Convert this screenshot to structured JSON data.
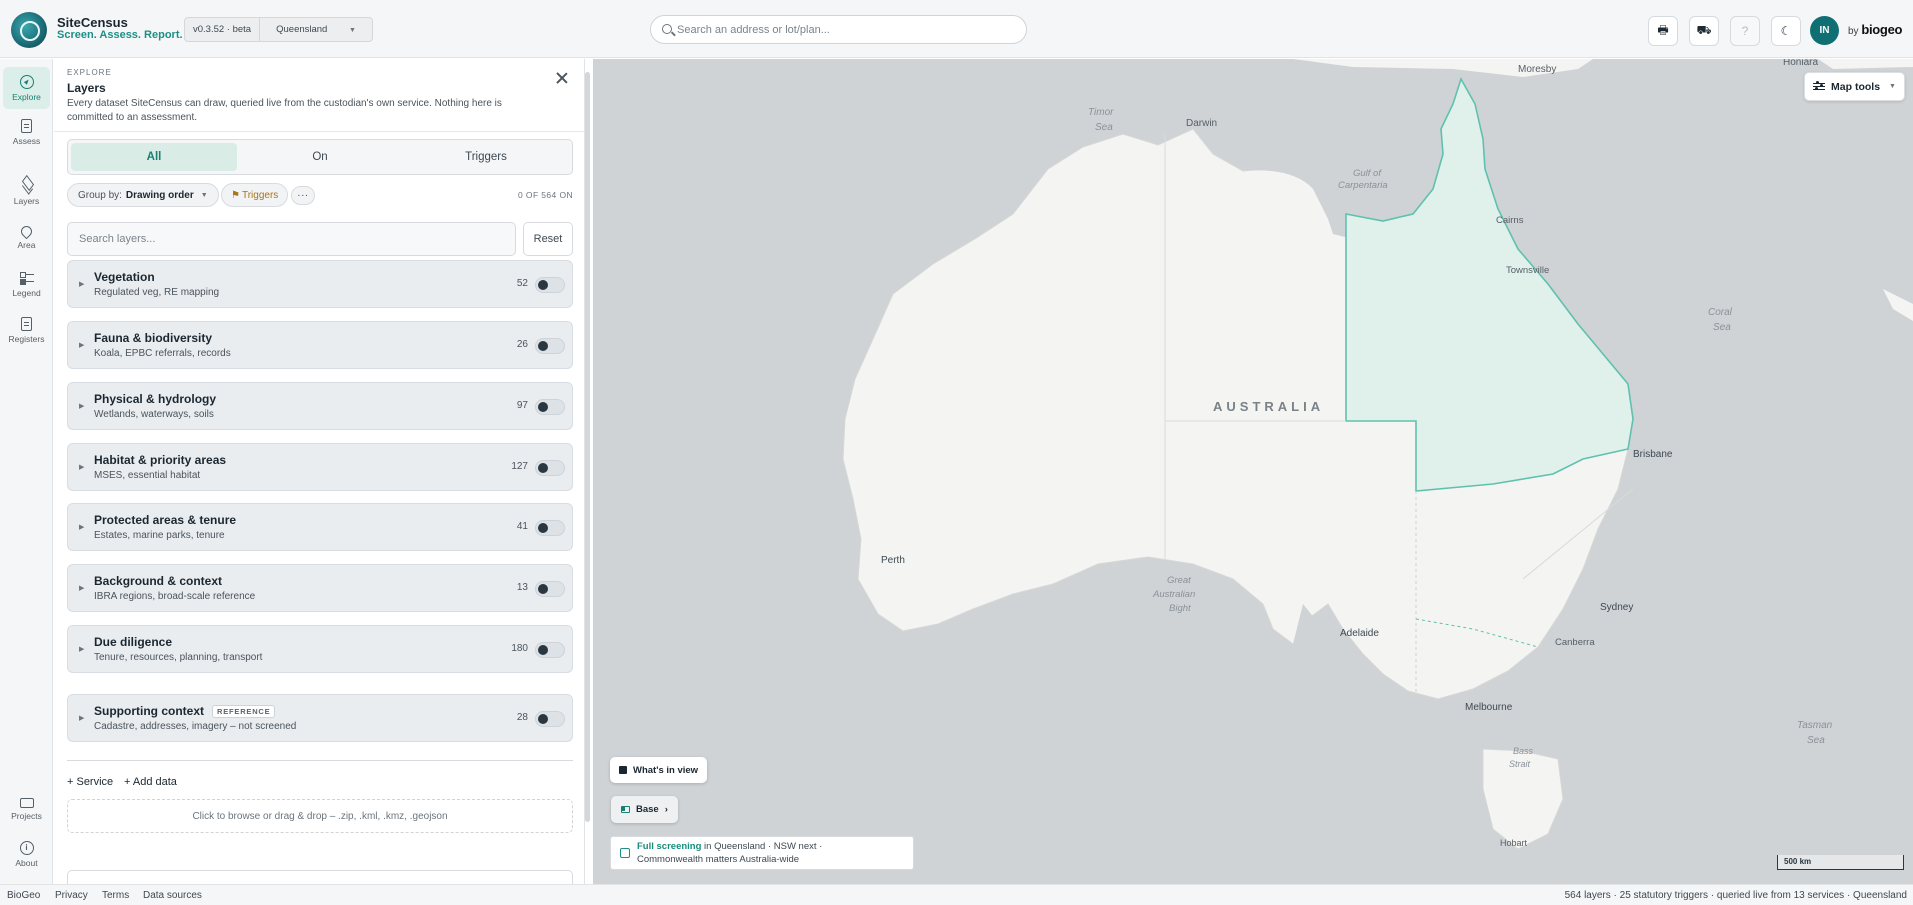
{
  "header": {
    "brand_name": "SiteCensus",
    "brand_tagline": "Screen. Assess. Report.",
    "version": "v0.3.52 · beta",
    "region": "Queensland",
    "search_placeholder": "Search an address or lot/plan...",
    "avatar_initials": "IN",
    "byline_prefix": "by",
    "byline_brand": "biogeo",
    "buttons": [
      "printer-icon",
      "vehicle-icon",
      "help-icon",
      "moon-icon"
    ]
  },
  "rail": {
    "top_items": [
      {
        "label": "Explore",
        "icon": "compass-icon",
        "active": true
      },
      {
        "label": "Assess",
        "icon": "document-icon",
        "active": false
      },
      {
        "label": "Layers",
        "icon": "layers-icon",
        "active": false
      },
      {
        "label": "Area",
        "icon": "map-pin-icon",
        "active": false
      },
      {
        "label": "Legend",
        "icon": "legend-icon",
        "active": false
      },
      {
        "label": "Registers",
        "icon": "register-icon",
        "active": false
      }
    ],
    "bottom_items": [
      {
        "label": "Projects",
        "icon": "folder-icon"
      },
      {
        "label": "About",
        "icon": "info-icon"
      }
    ]
  },
  "panel": {
    "eyebrow": "EXPLORE",
    "title": "Layers",
    "description": "Every dataset SiteCensus can draw, queried live from the custodian's own service. Nothing here is committed to an assessment.",
    "tabs": [
      {
        "label": "All",
        "active": true
      },
      {
        "label": "On",
        "active": false
      },
      {
        "label": "Triggers",
        "active": false
      }
    ],
    "group_by_label": "Group by:",
    "group_by_value": "Drawing order",
    "triggers_chip": "Triggers",
    "more_label": "···",
    "on_count": "0 OF 564 ON",
    "search_placeholder": "Search layers...",
    "reset_label": "Reset",
    "groups": [
      {
        "title": "Vegetation",
        "subtitle": "Regulated veg, RE mapping",
        "count": "52"
      },
      {
        "title": "Fauna & biodiversity",
        "subtitle": "Koala, EPBC referrals, records",
        "count": "26"
      },
      {
        "title": "Physical & hydrology",
        "subtitle": "Wetlands, waterways, soils",
        "count": "97"
      },
      {
        "title": "Habitat & priority areas",
        "subtitle": "MSES, essential habitat",
        "count": "127"
      },
      {
        "title": "Protected areas & tenure",
        "subtitle": "Estates, marine parks, tenure",
        "count": "41"
      },
      {
        "title": "Background & context",
        "subtitle": "IBRA regions, broad-scale reference",
        "count": "13"
      },
      {
        "title": "Due diligence",
        "subtitle": "Tenure, resources, planning, transport",
        "count": "180"
      },
      {
        "title": "Supporting context",
        "badge": "REFERENCE",
        "subtitle": "Cadastre, addresses, imagery – not screened",
        "count": "28"
      }
    ],
    "add_service": "+ Service",
    "add_data": "+ Add data",
    "dropzone": "Click to browse or drag & drop – .zip, .kml, .kmz, .geojson"
  },
  "map": {
    "tools_label": "Map tools",
    "whats_in_view": "What's in view",
    "base_label": "Base",
    "coverage_highlight": "Full screening",
    "coverage_rest": " in Queensland · NSW next ·",
    "coverage_line2": "Commonwealth matters Australia-wide",
    "scale": "500 km",
    "country_label": "AUSTRALIA",
    "labels": {
      "moresby": "Moresby",
      "honiara": "Honiara",
      "timor_1": "Timor",
      "timor_2": "Sea",
      "darwin": "Darwin",
      "gulf_1": "Gulf of",
      "gulf_2": "Carpentaria",
      "cairns": "Cairns",
      "townsville": "Townsville",
      "coral_1": "Coral",
      "coral_2": "Sea",
      "brisbane": "Brisbane",
      "perth": "Perth",
      "bight_1": "Great",
      "bight_2": "Australian",
      "bight_3": "Bight",
      "adelaide": "Adelaide",
      "sydney": "Sydney",
      "canberra": "Canberra",
      "melbourne": "Melbourne",
      "bass_1": "Bass",
      "bass_2": "Strait",
      "hobart": "Hobart",
      "tasman_1": "Tasman",
      "tasman_2": "Sea"
    },
    "colors": {
      "ocean": "#cfd3d6",
      "land": "#f4f4f3",
      "queensland_fill": "#e0f1ec",
      "queensland_stroke": "#5fc1ad"
    }
  },
  "footer": {
    "links": [
      "BioGeo",
      "Privacy",
      "Terms",
      "Data sources"
    ],
    "status": "564 layers · 25 statutory triggers · queried live from 13 services · Queensland"
  }
}
